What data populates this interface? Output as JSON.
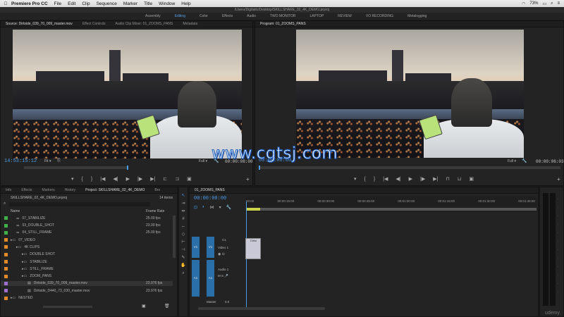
{
  "menubar": {
    "apple": "",
    "items": [
      "Premiere Pro CC",
      "File",
      "Edit",
      "Clip",
      "Sequence",
      "Marker",
      "Title",
      "Window",
      "Help"
    ],
    "status": "73%"
  },
  "titlebar": {
    "path": "/Users/Digitallc/Desktop/SKILLSHARE_02_4K_DEMO.prproj"
  },
  "workspaces": [
    "Assembly",
    "Editing",
    "Color",
    "Effects",
    "Audio",
    "TWO MONITOR",
    "LAPTOP",
    "REVIEW",
    "VO RECORDING",
    "Metalogging"
  ],
  "active_workspace": "Editing",
  "source": {
    "tabs": [
      "Source: Dirtside_039_70_009_master.mov",
      "Effect Controls",
      "Audio Clip Mixer: 01_ZOOMS_PANS",
      "Metadata"
    ],
    "timecode": "14:53:15:12",
    "fit": "Fit",
    "res": "Full",
    "duration": "00:00:08:00"
  },
  "program": {
    "tabs": [
      "Program: 01_ZOOMS_PANS"
    ],
    "timecode": "00:00:00:00",
    "res": "Full",
    "duration": "00:00:06:03"
  },
  "project": {
    "tabs": [
      "Info",
      "Effects",
      "Markers",
      "History",
      "Project: SKILLSHARE_02_4K_DEMO",
      "Bro"
    ],
    "file": "SKILLSHARE_02_4K_DEMO.prproj",
    "count": "14 items",
    "col_name": "Name",
    "col_rate": "Frame Rate",
    "rows": [
      {
        "name": "07_STABILIZE",
        "rate": "25.00 fps",
        "color": "#3fb04a",
        "indent": 1
      },
      {
        "name": "03_DOUBLE_SHOT",
        "rate": "23.00 fps",
        "color": "#3fb04a",
        "indent": 1
      },
      {
        "name": "04_STILL_FRAME",
        "rate": "25.00 fps",
        "color": "#3fb04a",
        "indent": 1
      },
      {
        "name": "07_VIDEO",
        "rate": "",
        "color": "#e08a2a",
        "indent": 0
      },
      {
        "name": "4K CLIPS",
        "rate": "",
        "color": "#e08a2a",
        "indent": 1
      },
      {
        "name": "DOUBLE SHOT",
        "rate": "",
        "color": "#e08a2a",
        "indent": 2
      },
      {
        "name": "STABILIZE",
        "rate": "",
        "color": "#e08a2a",
        "indent": 2
      },
      {
        "name": "STILL_FRAME",
        "rate": "",
        "color": "#e08a2a",
        "indent": 2
      },
      {
        "name": "ZOOM_PANS",
        "rate": "",
        "color": "#e08a2a",
        "indent": 2
      },
      {
        "name": "Dirtside_039_70_009_master.mov",
        "rate": "23.976 fps",
        "color": "#a070d0",
        "indent": 3
      },
      {
        "name": "Dirtside_D440_73_030_master.mov",
        "rate": "23.976 fps",
        "color": "#a070d0",
        "indent": 3
      },
      {
        "name": "NESTED",
        "rate": "",
        "color": "#e08a2a",
        "indent": 0
      }
    ]
  },
  "timeline": {
    "tab": "01_ZOOMS_PANS",
    "timecode": "00:00:00:00",
    "ruler": [
      "00:00",
      "00:00:15:00",
      "00:00:30:00",
      "00:00:45:00",
      "00:01:00:00",
      "00:01:15:00",
      "00:01:30:00",
      "00:01:45:00"
    ],
    "tracks": {
      "v1_src": "V1",
      "v1": "V1",
      "video1": "Video 1",
      "a1_src": "A1",
      "a1": "A1",
      "audio1": "Audio 1",
      "master": "Master",
      "master_val": "0.0",
      "c1": "C1"
    },
    "clip": "Dirtsi"
  },
  "watermark": "www.cgtsj.com",
  "brand": "udemy"
}
